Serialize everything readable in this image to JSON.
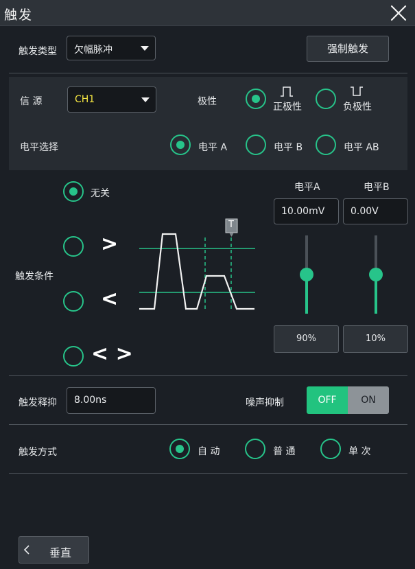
{
  "title": "触发",
  "trigger_type": {
    "label": "触发类型",
    "value": "欠幅脉冲"
  },
  "force_trigger": "强制触发",
  "source": {
    "label": "信 源",
    "value": "CH1"
  },
  "polarity": {
    "label": "极性",
    "options": [
      "正极性",
      "负极性"
    ],
    "selected": 0
  },
  "level_select": {
    "label": "电平选择",
    "options": [
      "电平 A",
      "电平 B",
      "电平 AB"
    ],
    "selected": 0
  },
  "condition": {
    "label": "触发条件",
    "options": [
      "无关",
      ">",
      "<",
      "< >"
    ],
    "selected": 0
  },
  "levels": {
    "a": {
      "label": "电平A",
      "value": "10.00mV",
      "percent": "90%",
      "slider_fraction": 0.46
    },
    "b": {
      "label": "电平B",
      "value": "0.00V",
      "percent": "10%",
      "slider_fraction": 0.46
    }
  },
  "trigger_marker": "T",
  "holdoff": {
    "label": "触发释抑",
    "value": "8.00ns"
  },
  "noise": {
    "label": "噪声抑制",
    "off": "OFF",
    "on": "ON",
    "state": "OFF"
  },
  "mode": {
    "label": "触发方式",
    "options": [
      "自 动",
      "普 通",
      "单 次"
    ],
    "selected": 0
  },
  "back_button": "垂直",
  "colors": {
    "accent": "#27c48a",
    "source_text": "#f5e642"
  }
}
